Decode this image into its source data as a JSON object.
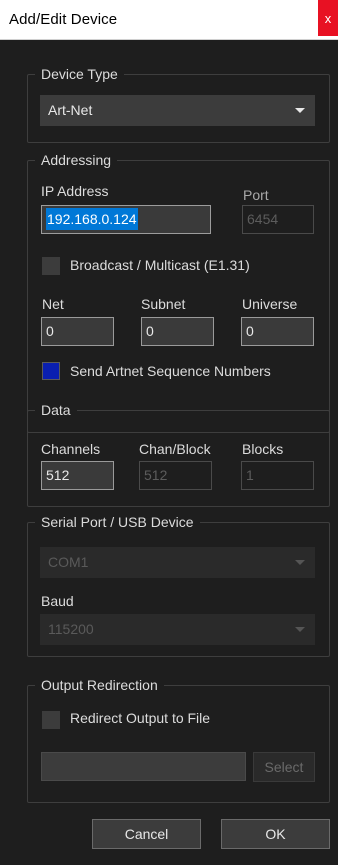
{
  "window": {
    "title": "Add/Edit Device",
    "close_glyph": "x"
  },
  "device_type": {
    "legend": "Device Type",
    "value": "Art-Net"
  },
  "addressing": {
    "legend": "Addressing",
    "ip_label": "IP Address",
    "ip_value": "192.168.0.124",
    "port_label": "Port",
    "port_value": "6454",
    "broadcast_label": "Broadcast / Multicast (E1.31)",
    "broadcast_checked": false,
    "net_label": "Net",
    "net_value": "0",
    "subnet_label": "Subnet",
    "subnet_value": "0",
    "universe_label": "Universe",
    "universe_value": "0",
    "sequence_label": "Send Artnet Sequence Numbers",
    "sequence_checked": true
  },
  "data": {
    "legend": "Data",
    "channels_label": "Channels",
    "channels_value": "512",
    "chan_block_label": "Chan/Block",
    "chan_block_value": "512",
    "blocks_label": "Blocks",
    "blocks_value": "1"
  },
  "serial": {
    "legend": "Serial Port / USB Device",
    "port_value": "COM1",
    "baud_label": "Baud",
    "baud_value": "115200"
  },
  "output": {
    "legend": "Output Redirection",
    "redirect_label": "Redirect Output to File",
    "redirect_checked": false,
    "file_value": "",
    "select_label": "Select"
  },
  "footer": {
    "cancel_label": "Cancel",
    "ok_label": "OK"
  },
  "colors": {
    "background": "#1e1e1e",
    "selection": "#0078d7",
    "checked": "#0a1fb0",
    "close": "#e81123"
  }
}
